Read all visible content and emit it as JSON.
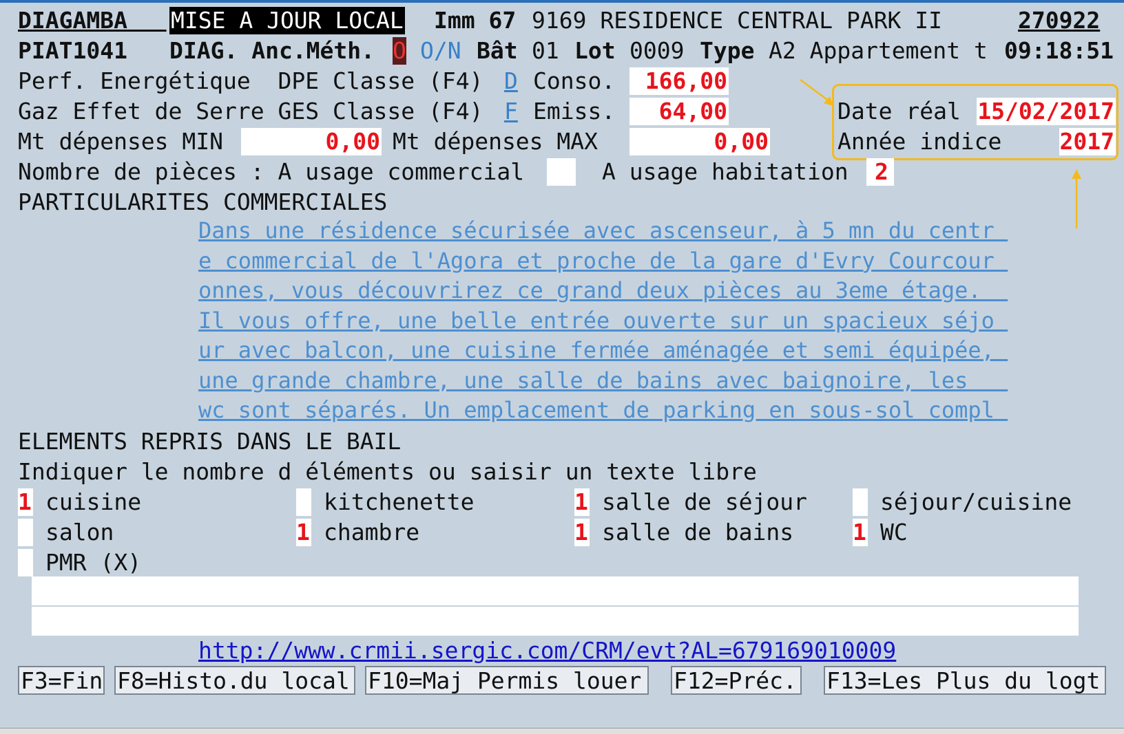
{
  "header": {
    "program": "DIAGAMBA",
    "title": "MISE A JOUR LOCAL",
    "imm_label": "Imm 67",
    "imm_value": "9169 RESIDENCE CENTRAL PARK II",
    "code": "270922",
    "screen_id": "PIAT1041",
    "diag_label": "DIAG. Anc.Méth.",
    "diag_value": "O",
    "on_hint": "O/N",
    "bat_label": "Bât",
    "bat_value": "01",
    "lot_label": "Lot",
    "lot_value": "0009",
    "type_label": "Type",
    "type_value": "A2 Appartement t",
    "time": "09:18:51"
  },
  "energy": {
    "perf_label": "Perf. Energétique  DPE Classe (F4)",
    "dpe_class": "D",
    "conso_label": "Conso.",
    "conso_value": "166,00",
    "gaz_label": "Gaz Effet de Serre GES Classe (F4)",
    "ges_class": "F",
    "emiss_label": "Emiss.",
    "emiss_value": "64,00",
    "min_label": "Mt dépenses MIN",
    "min_value": "0,00",
    "max_label": "Mt dépenses MAX",
    "max_value": "0,00",
    "date_label": "Date réal",
    "date_value": "15/02/2017",
    "annee_label": "Année indice",
    "annee_value": "2017"
  },
  "rooms": {
    "label": "Nombre de pièces : A usage commercial",
    "commercial_value": "",
    "habitation_label": "A usage habitation",
    "habitation_value": "2"
  },
  "particularites": {
    "heading": "PARTICULARITES COMMERCIALES",
    "lines": [
      "Dans une résidence sécurisée avec ascenseur, à 5 mn du centr ",
      "e commercial de l'Agora et proche de la gare d'Evry Courcour ",
      "onnes, vous découvrirez ce grand deux pièces au 3eme étage.  ",
      "Il vous offre, une belle entrée ouverte sur un spacieux séjo ",
      "ur avec balcon, une cuisine fermée aménagée et semi équipée, ",
      "une grande chambre, une salle de bains avec baignoire, les   ",
      "wc sont séparés. Un emplacement de parking en sous-sol compl "
    ]
  },
  "elements": {
    "heading": "ELEMENTS REPRIS DANS LE BAIL",
    "instruction": "Indiquer le nombre d éléments ou saisir un texte libre",
    "items": [
      {
        "qty": "1",
        "label": "cuisine"
      },
      {
        "qty": "",
        "label": "kitchenette"
      },
      {
        "qty": "1",
        "label": "salle de séjour"
      },
      {
        "qty": "",
        "label": "séjour/cuisine"
      },
      {
        "qty": "",
        "label": "salon"
      },
      {
        "qty": "1",
        "label": "chambre"
      },
      {
        "qty": "1",
        "label": "salle de bains"
      },
      {
        "qty": "1",
        "label": "WC"
      },
      {
        "qty": "",
        "label": "PMR (X)"
      }
    ],
    "free_text_1": "",
    "free_text_2": ""
  },
  "link": "http://www.crmii.sergic.com/CRM/evt?AL=679169010009",
  "fkeys": [
    "F3=Fin",
    "F8=Histo.du local",
    "F10=Maj Permis louer",
    "F12=Préc.",
    "F13=Les Plus du logt"
  ],
  "colors": {
    "background": "#c6d3de",
    "value_red": "#e8141c",
    "accent_blue": "#3a80c8",
    "callout": "#f5b91c"
  }
}
